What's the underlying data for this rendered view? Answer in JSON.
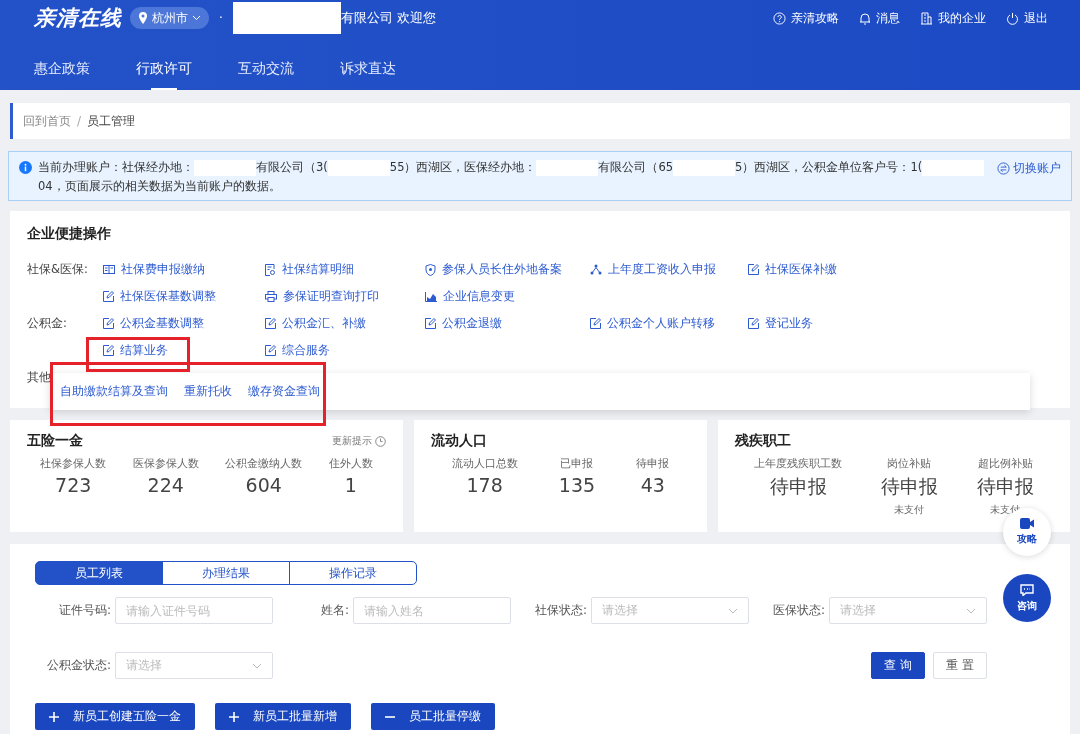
{
  "header": {
    "logo": "亲清在线",
    "city": "杭州市",
    "welcome_prefix": "·",
    "welcome": "有限公司 欢迎您",
    "links": [
      "亲清攻略",
      "消息",
      "我的企业",
      "退出"
    ]
  },
  "nav": [
    {
      "label": "惠企政策",
      "selected": false
    },
    {
      "label": "行政许可",
      "selected": true
    },
    {
      "label": "互动交流",
      "selected": false
    },
    {
      "label": "诉求直达",
      "selected": false
    }
  ],
  "breadcrumb": {
    "items": [
      "回到首页",
      "员工管理"
    ],
    "separator": "/"
  },
  "account_notice": {
    "parts": [
      {
        "kind": "text",
        "text": "当前办理账户：社保经办地："
      },
      {
        "kind": "redacted"
      },
      {
        "kind": "text",
        "text": "有限公司（3("
      },
      {
        "kind": "redacted"
      },
      {
        "kind": "text",
        "text": "55）西湖区，医保经办地："
      },
      {
        "kind": "redacted"
      },
      {
        "kind": "text",
        "text": "有限公司（65"
      },
      {
        "kind": "redacted"
      },
      {
        "kind": "text",
        "text": "5）西湖区，公积金单位客户号："
      },
      {
        "kind": "text",
        "text": "1("
      },
      {
        "kind": "redacted"
      },
      {
        "kind": "text",
        "text": "04，页面展示的相关数据为当前账户的数据。"
      }
    ],
    "switch": "切换账户"
  },
  "quick_ops": {
    "title": "企业便捷操作",
    "rows": [
      {
        "label": "社保&医保:",
        "items": [
          "社保费申报缴纳",
          "社保结算明细",
          "参保人员长住外地备案",
          "上年度工资收入申报",
          "社保医保补缴"
        ]
      },
      {
        "label": "",
        "items": [
          "社保医保基数调整",
          "参保证明查询打印",
          "企业信息变更"
        ]
      },
      {
        "label": "公积金:",
        "items": [
          "公积金基数调整",
          "公积金汇、补缴",
          "公积金退缴",
          "公积金个人账户转移",
          "登记业务"
        ]
      },
      {
        "label": "",
        "items": [
          "结算业务",
          "综合服务"
        ]
      },
      {
        "label": "其他",
        "items": []
      }
    ],
    "popup": [
      "自助缴款结算及查询",
      "重新托收",
      "缴存资金查询"
    ]
  },
  "stats": [
    {
      "title": "五险一金",
      "hint": "更新提示",
      "metrics": [
        {
          "label": "社保参保人数",
          "value": "723"
        },
        {
          "label": "医保参保人数",
          "value": "224"
        },
        {
          "label": "公积金缴纳人数",
          "value": "604"
        },
        {
          "label": "住外人数",
          "value": "1"
        }
      ]
    },
    {
      "title": "流动人口",
      "metrics": [
        {
          "label": "流动人口总数",
          "value": "178"
        },
        {
          "label": "已申报",
          "value": "135"
        },
        {
          "label": "待申报",
          "value": "43"
        }
      ]
    },
    {
      "title": "残疾职工",
      "metrics": [
        {
          "label": "上年度残疾职工数",
          "value": "待申报"
        },
        {
          "label": "岗位补贴",
          "value": "待申报",
          "note": "未支付"
        },
        {
          "label": "超比例补贴",
          "value": "待申报",
          "note": "未支付"
        }
      ]
    }
  ],
  "tabs": [
    {
      "label": "员工列表",
      "selected": true
    },
    {
      "label": "办理结果",
      "selected": false
    },
    {
      "label": "操作记录",
      "selected": false
    }
  ],
  "filters": [
    {
      "label": "证件号码:",
      "kind": "text",
      "placeholder": "请输入证件号码"
    },
    {
      "label": "姓名:",
      "kind": "text",
      "placeholder": "请输入姓名"
    },
    {
      "label": "社保状态:",
      "kind": "select",
      "placeholder": "请选择"
    },
    {
      "label": "医保状态:",
      "kind": "select",
      "placeholder": "请选择"
    },
    {
      "label": "公积金状态:",
      "kind": "select",
      "placeholder": "请选择"
    }
  ],
  "form_buttons": [
    {
      "label": "查 询",
      "kind": "primary"
    },
    {
      "label": "重 置",
      "kind": "plain"
    }
  ],
  "actions": [
    {
      "label": "新员工创建五险一金",
      "kind": "add"
    },
    {
      "label": "新员工批量新增",
      "kind": "add"
    },
    {
      "label": "员工批量停缴",
      "kind": "remove"
    }
  ],
  "float_buttons": [
    {
      "label": "攻略",
      "kind": "guide"
    },
    {
      "label": "咨询",
      "kind": "chat"
    }
  ]
}
